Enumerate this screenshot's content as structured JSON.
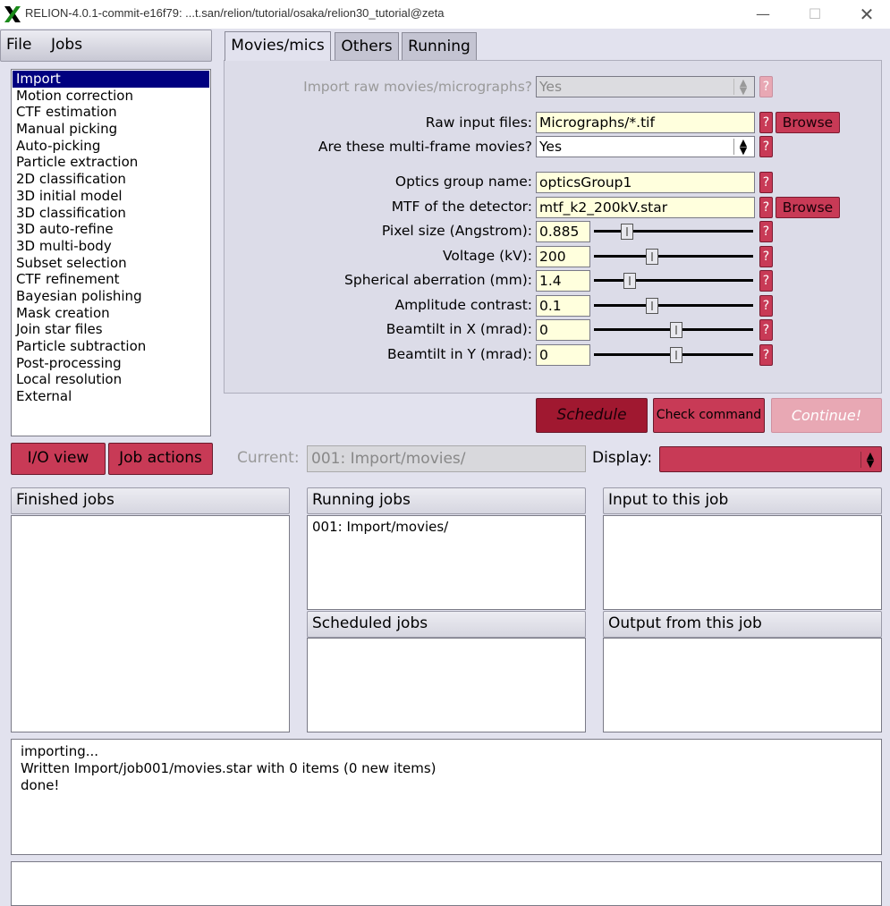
{
  "window": {
    "title": "RELION-4.0.1-commit-e16f79: ...t.san/relion/tutorial/osaka/relion30_tutorial@zeta",
    "minimize": "—",
    "maximize": "☐",
    "close": "✕"
  },
  "menu": {
    "file": "File",
    "jobs": "Jobs"
  },
  "job_types": [
    "Import",
    "Motion correction",
    "CTF estimation",
    "Manual picking",
    "Auto-picking",
    "Particle extraction",
    "2D classification",
    "3D initial model",
    "3D classification",
    "3D auto-refine",
    "3D multi-body",
    "Subset selection",
    "CTF refinement",
    "Bayesian polishing",
    "Mask creation",
    "Join star files",
    "Particle subtraction",
    "Post-processing",
    "Local resolution",
    "External"
  ],
  "selected_job_type": "Import",
  "tabs": {
    "movies": "Movies/mics",
    "others": "Others",
    "running": "Running"
  },
  "form": {
    "import_raw": {
      "label": "Import raw movies/micrographs?",
      "value": "Yes"
    },
    "raw_input": {
      "label": "Raw input files:",
      "value": "Micrographs/*.tif",
      "browse": "Browse"
    },
    "multiframe": {
      "label": "Are these multi-frame movies?",
      "value": "Yes"
    },
    "optics_group": {
      "label": "Optics group name:",
      "value": "opticsGroup1"
    },
    "mtf": {
      "label": "MTF of the detector:",
      "value": "mtf_k2_200kV.star",
      "browse": "Browse"
    },
    "pixel_size": {
      "label": "Pixel size (Angstrom):",
      "value": "0.885",
      "slider_fraction": 0.19
    },
    "voltage": {
      "label": "Voltage (kV):",
      "value": "200",
      "slider_fraction": 0.36
    },
    "cs": {
      "label": "Spherical aberration (mm):",
      "value": "1.4",
      "slider_fraction": 0.21
    },
    "amp_contrast": {
      "label": "Amplitude contrast:",
      "value": "0.1",
      "slider_fraction": 0.36
    },
    "beamtilt_x": {
      "label": "Beamtilt in X (mrad):",
      "value": "0",
      "slider_fraction": 0.52
    },
    "beamtilt_y": {
      "label": "Beamtilt in Y (mrad):",
      "value": "0",
      "slider_fraction": 0.52
    }
  },
  "help_mark": "?",
  "buttons": {
    "schedule": "Schedule",
    "check_command": "Check command",
    "continue": "Continue!",
    "io_view": "I/O view",
    "job_actions": "Job actions"
  },
  "current": {
    "label": "Current:",
    "value": "001: Import/movies/"
  },
  "display": {
    "label": "Display:",
    "value": ""
  },
  "panels": {
    "finished": {
      "title": "Finished jobs",
      "items": []
    },
    "running": {
      "title": "Running jobs",
      "items": [
        "001: Import/movies/"
      ]
    },
    "scheduled": {
      "title": "Scheduled jobs",
      "items": []
    },
    "input": {
      "title": "Input to this job",
      "items": []
    },
    "output": {
      "title": "Output from this job",
      "items": []
    }
  },
  "log": {
    "line1": "importing...",
    "line2": "Written Import/job001/movies.star with 0 items (0 new items)",
    "line3": "done!"
  },
  "colors": {
    "button": "#c83a56",
    "schedule": "#a01830",
    "selected": "#000080",
    "field": "#ffffdd",
    "background": "#e2e2ee"
  }
}
